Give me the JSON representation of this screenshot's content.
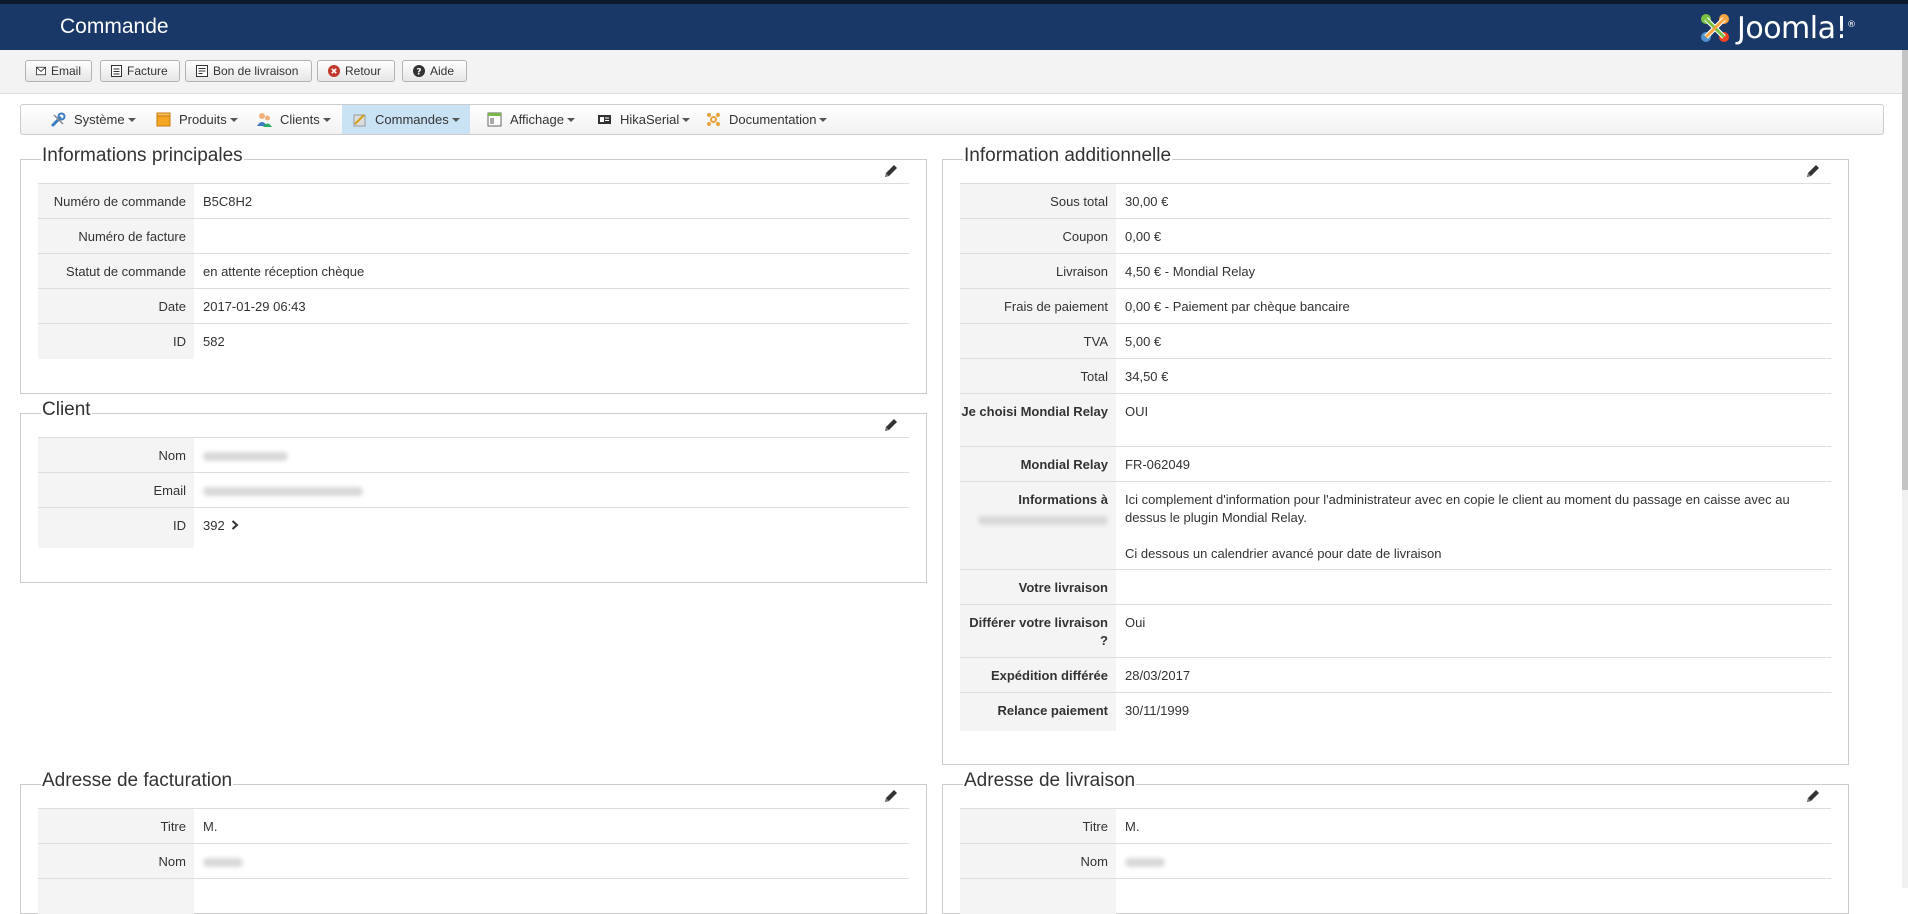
{
  "header": {
    "title": "Commande",
    "logo": {
      "text": "Joomla!",
      "superscript": "®"
    }
  },
  "toolbar": {
    "buttons": [
      {
        "label": "Email",
        "icon": "envelope-icon"
      },
      {
        "label": "Facture",
        "icon": "invoice-icon"
      },
      {
        "label": "Bon de livraison",
        "icon": "delivery-slip-icon"
      },
      {
        "label": "Retour",
        "icon": "cancel-circle-icon"
      },
      {
        "label": "Aide",
        "icon": "help-circle-icon"
      }
    ]
  },
  "menu": {
    "items": [
      {
        "label": "Système",
        "icon": "wrench-icon"
      },
      {
        "label": "Produits",
        "icon": "box-icon"
      },
      {
        "label": "Clients",
        "icon": "users-icon"
      },
      {
        "label": "Commandes",
        "icon": "orders-icon",
        "active": true
      },
      {
        "label": "Affichage",
        "icon": "display-icon"
      },
      {
        "label": "HikaSerial",
        "icon": "serial-icon"
      },
      {
        "label": "Documentation",
        "icon": "docs-icon"
      }
    ]
  },
  "main_info": {
    "title": "Informations principales",
    "rows": [
      {
        "label": "Numéro de commande",
        "value": "B5C8H2"
      },
      {
        "label": "Numéro de facture",
        "value": ""
      },
      {
        "label": "Statut de commande",
        "value": "en attente réception chèque"
      },
      {
        "label": "Date",
        "value": "2017-01-29 06:43"
      },
      {
        "label": "ID",
        "value": "582"
      }
    ]
  },
  "client": {
    "title": "Client",
    "rows": [
      {
        "label": "Nom",
        "value": ""
      },
      {
        "label": "Email",
        "value": ""
      },
      {
        "label": "ID",
        "value": "392"
      }
    ]
  },
  "additional": {
    "title": "Information additionnelle",
    "rows": [
      {
        "label": "Sous total",
        "value": "30,00 €"
      },
      {
        "label": "Coupon",
        "value": "0,00 €"
      },
      {
        "label": "Livraison",
        "value": "4,50 € - Mondial Relay"
      },
      {
        "label": "Frais de paiement",
        "value": "0,00 € - Paiement par chèque bancaire"
      },
      {
        "label": "TVA",
        "value": "5,00 €"
      },
      {
        "label": "Total",
        "value": "34,50 €"
      },
      {
        "label": "Je choisi Mondial Relay",
        "value": "OUI"
      },
      {
        "label": "Mondial Relay",
        "value": "FR-062049"
      },
      {
        "label": "Informations à",
        "value": "Ici complement d'information pour l'administrateur avec en copie le client au moment du passage en caisse avec au dessus le plugin Mondial Relay.",
        "value2": "Ci dessous un calendrier avancé pour date de livraison"
      },
      {
        "label": "Votre livraison",
        "value": ""
      },
      {
        "label": "Différer votre livraison ?",
        "value": "Oui"
      },
      {
        "label": "Expédition différée",
        "value": "28/03/2017"
      },
      {
        "label": "Relance paiement",
        "value": "30/11/1999"
      }
    ]
  },
  "billing": {
    "title": "Adresse de facturation",
    "rows": [
      {
        "label": "Titre",
        "value": "M."
      },
      {
        "label": "Nom",
        "value": ""
      }
    ]
  },
  "shipping": {
    "title": "Adresse de livraison",
    "rows": [
      {
        "label": "Titre",
        "value": "M."
      },
      {
        "label": "Nom",
        "value": ""
      }
    ]
  }
}
